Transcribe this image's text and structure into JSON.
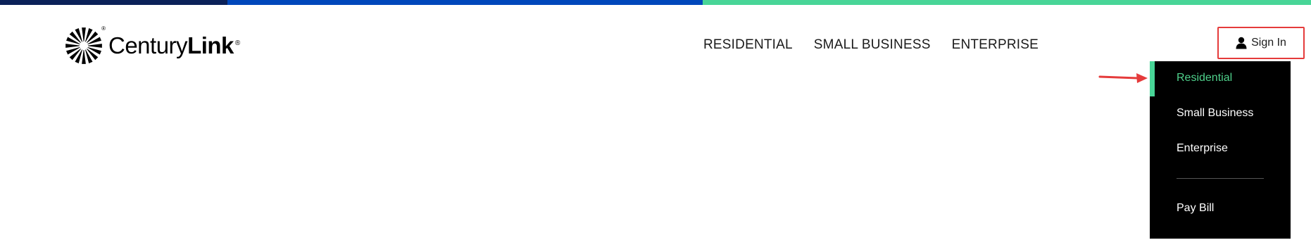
{
  "colors": {
    "topbar": [
      "#0b2159",
      "#0047bb",
      "#48d597"
    ],
    "accent_green": "#48d597",
    "highlight_red": "#e53b3b",
    "dropdown_bg": "#000000"
  },
  "logo": {
    "name_regular": "Century",
    "name_bold": "Link",
    "registered": "®",
    "icon": "centurylink-starburst-icon"
  },
  "nav": {
    "items": [
      "RESIDENTIAL",
      "SMALL BUSINESS",
      "ENTERPRISE"
    ]
  },
  "signin": {
    "label": "Sign In",
    "icon": "user-icon"
  },
  "dropdown": {
    "items": [
      {
        "label": "Residential",
        "active": true
      },
      {
        "label": "Small Business",
        "active": false
      },
      {
        "label": "Enterprise",
        "active": false
      }
    ],
    "footer_item": "Pay Bill"
  },
  "annotation": {
    "arrow_icon": "red-arrow-icon"
  }
}
